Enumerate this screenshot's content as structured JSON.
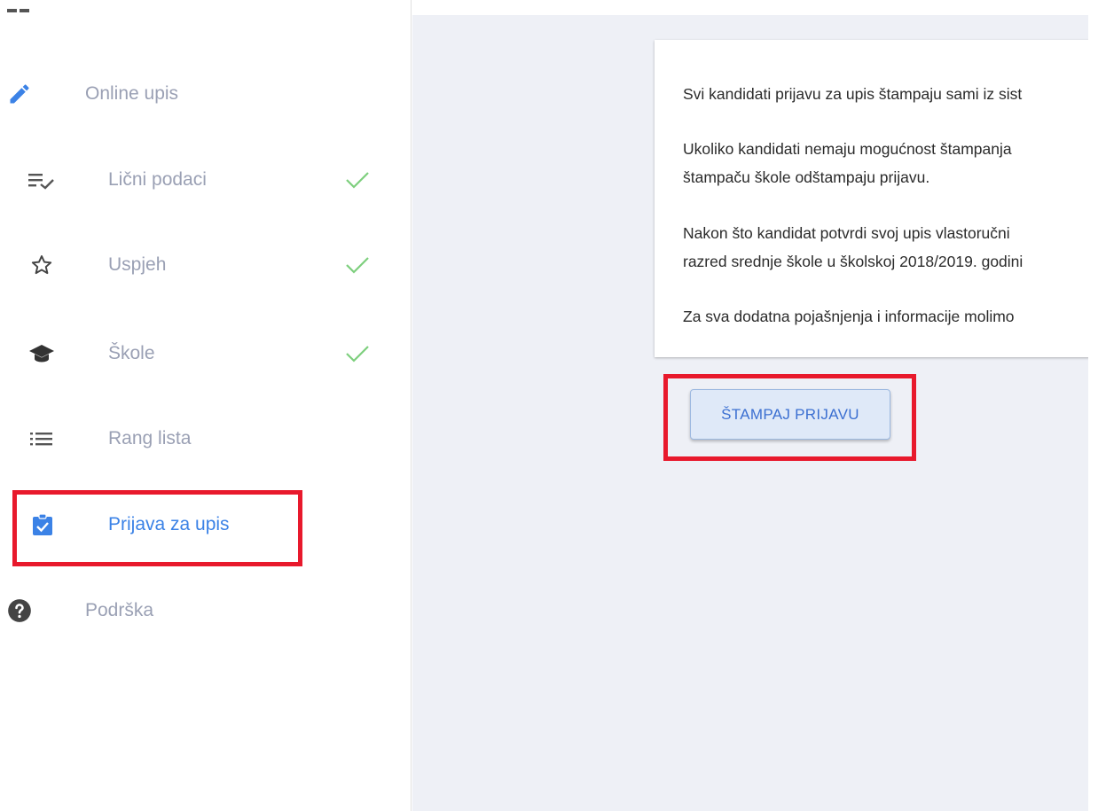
{
  "sidebar": {
    "items": [
      {
        "label": "Online upis",
        "icon": "pencil-icon"
      },
      {
        "label": "Lični podaci",
        "icon": "checklist-icon",
        "completed": true
      },
      {
        "label": "Uspjeh",
        "icon": "star-outline-icon",
        "completed": true
      },
      {
        "label": "Škole",
        "icon": "graduation-cap-icon",
        "completed": true
      },
      {
        "label": "Rang lista",
        "icon": "list-icon"
      },
      {
        "label": "Prijava za upis",
        "icon": "clipboard-check-icon",
        "active": true
      },
      {
        "label": "Podrška",
        "icon": "help-circle-icon"
      }
    ]
  },
  "card": {
    "lines": [
      "Svi kandidati prijavu za upis štampaju sami iz sist",
      "Ukoliko kandidati nemaju mogućnost štampanja",
      "štampaču škole odštampaju prijavu.",
      "Nakon što kandidat potvrdi svoj upis vlastoručni",
      "razred srednje škole u školskoj 2018/2019. godini",
      "Za sva dodatna pojašnjenja i informacije molimo"
    ]
  },
  "actions": {
    "print_label": "ŠTAMPAJ PRIJAVU"
  },
  "colors": {
    "accent": "#3b82e6",
    "check": "#7dcf7d",
    "highlight": "#e8192c",
    "muted_text": "#9aa0b4",
    "main_bg": "#eef0f6"
  }
}
